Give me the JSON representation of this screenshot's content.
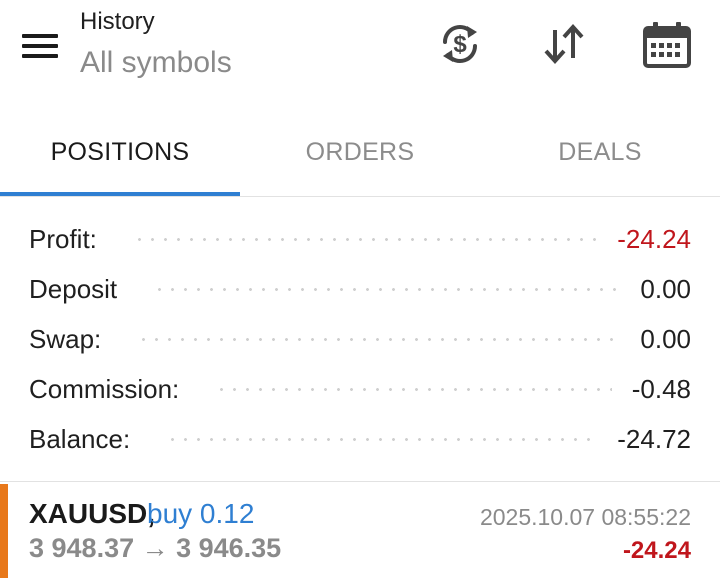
{
  "header": {
    "title": "History",
    "subtitle": "All symbols"
  },
  "toolbar": {
    "icons": [
      "currency-refresh-icon",
      "sort-icon",
      "calendar-icon"
    ]
  },
  "tabs": [
    {
      "label": "POSITIONS",
      "active": true
    },
    {
      "label": "ORDERS",
      "active": false
    },
    {
      "label": "DEALS",
      "active": false
    }
  ],
  "summary": [
    {
      "label": "Profit:",
      "value": "-24.24",
      "negative": true
    },
    {
      "label": "Deposit",
      "value": "0.00",
      "negative": false
    },
    {
      "label": "Swap:",
      "value": "0.00",
      "negative": false
    },
    {
      "label": "Commission:",
      "value": "-0.48",
      "negative": false
    },
    {
      "label": "Balance:",
      "value": "-24.72",
      "negative": false
    }
  ],
  "trades": [
    {
      "symbol": "XAUUSD,",
      "direction": "buy 0.12",
      "prices": "3 948.37 → 3 946.35",
      "time": "2025.10.07 08:55:22",
      "profit": "-24.24"
    }
  ],
  "colors": {
    "accent": "#2f7fd2",
    "negative": "#c0161c",
    "trade_marker": "#e8781a",
    "muted": "#8a8a8a"
  }
}
